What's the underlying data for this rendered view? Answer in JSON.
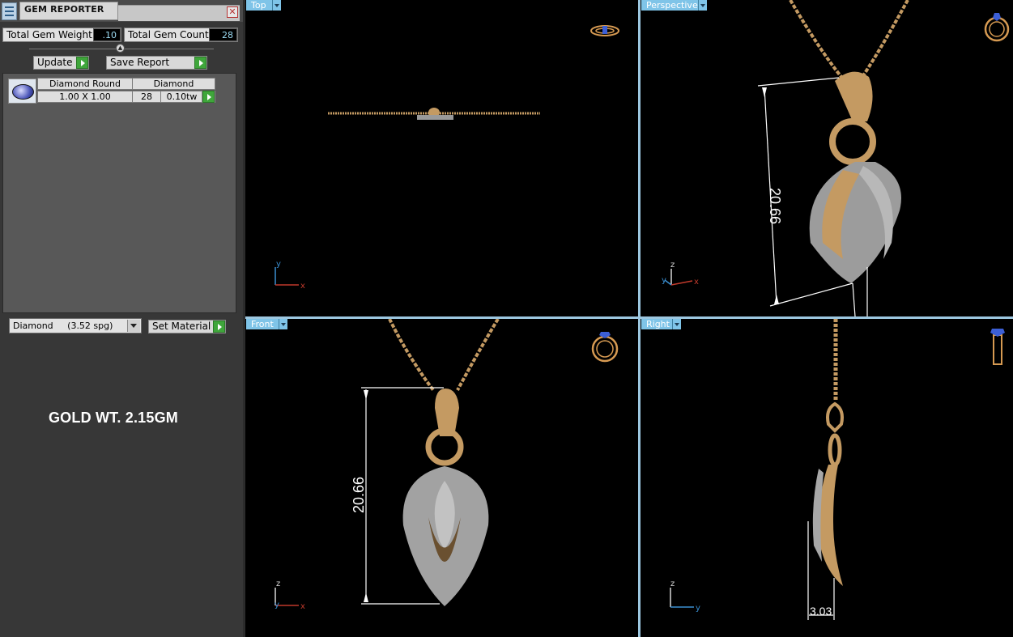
{
  "window": {
    "title": "GEM REPORTER",
    "close_glyph": "✕"
  },
  "totals": {
    "weight_label": "Total Gem Weight",
    "weight_value": ".10",
    "count_label": "Total Gem Count",
    "count_value": "28"
  },
  "buttons": {
    "update": "Update",
    "save_report": "Save Report",
    "set_material": "Set Material"
  },
  "gem_list": {
    "headers": [
      "Diamond Round",
      "Diamond"
    ],
    "rows": [
      {
        "shape": "Diamond Round",
        "material": "Diamond",
        "size": "1.00 X 1.00",
        "count": "28",
        "weight": "0.10tw"
      }
    ]
  },
  "material_select": {
    "value": "Diamond     (3.52 spg)"
  },
  "gold_weight": "GOLD WT. 2.15GM",
  "viewports": {
    "top": {
      "label": "Top",
      "axes": [
        "y",
        "x"
      ]
    },
    "perspective": {
      "label": "Perspective",
      "axes": [
        "z",
        "y",
        "x"
      ],
      "dimension": "20.66"
    },
    "front": {
      "label": "Front",
      "axes": [
        "z",
        "y",
        "x"
      ],
      "dimension": "20.66"
    },
    "right": {
      "label": "Right",
      "axes": [
        "z",
        "y"
      ],
      "dimension": "3.03"
    }
  },
  "colors": {
    "gold": "#c49a62",
    "viewport_tab": "#7fc4e8",
    "axis_x": "#c0392b",
    "axis_y": "#3a8fd1",
    "axis_z": "#d8d8d8"
  }
}
